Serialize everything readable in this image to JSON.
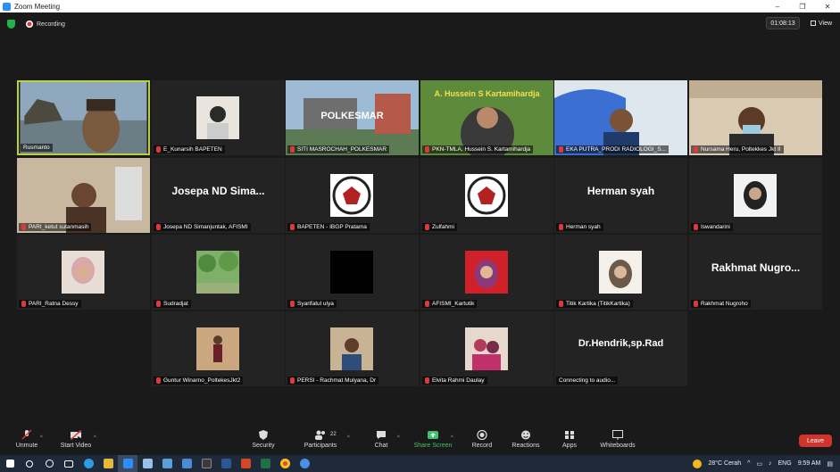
{
  "window": {
    "title": "Zoom Meeting",
    "min": "–",
    "max": "❐",
    "close": "✕"
  },
  "topbar": {
    "recording_label": "Recording",
    "timer": "01:08:13",
    "view_label": "View"
  },
  "participants": [
    {
      "name": "Rusmanto",
      "type": "video",
      "muted": false
    },
    {
      "name": "E_Kunarsih BAPETEN",
      "type": "photo",
      "muted": true
    },
    {
      "name": "SITI MASROCHAH_POLKESMAR",
      "type": "video",
      "muted": true,
      "overlay_text": "POLKESMAR"
    },
    {
      "name": "PKN-TMLA, Hussein S. Kartamihardja",
      "type": "video",
      "muted": true,
      "overlay_text": "A. Hussein S Kartamihardja"
    },
    {
      "name": "EKA PUTRA_PRODI RADIOLOGI_S...",
      "type": "video",
      "muted": true
    },
    {
      "name": "Nursama Heru, Poltekkes Jkt II",
      "type": "video",
      "muted": true
    },
    {
      "name": "PARI_ketut sutanmasih",
      "type": "video",
      "muted": true
    },
    {
      "name": "Josepa ND Simanjuntak, AFISMI",
      "type": "text",
      "muted": true,
      "display": "Josepa ND Sima..."
    },
    {
      "name": "BAPETEN - IBGP Pratama",
      "type": "logo",
      "muted": true
    },
    {
      "name": "Zulfahmi",
      "type": "logo",
      "muted": true
    },
    {
      "name": "Herman syah",
      "type": "text",
      "muted": true,
      "display": "Herman syah"
    },
    {
      "name": "Iswandarini",
      "type": "photo",
      "muted": true
    },
    {
      "name": "PARI_Ratna Dessy",
      "type": "photo",
      "muted": true
    },
    {
      "name": "Sudradjat",
      "type": "photo",
      "muted": true
    },
    {
      "name": "Syarifatul ulya",
      "type": "photo",
      "muted": true
    },
    {
      "name": "AFISMI_Kartutik",
      "type": "photo",
      "muted": true
    },
    {
      "name": "Titik Kartika (TitikKartika)",
      "type": "photo",
      "muted": true
    },
    {
      "name": "Rakhmat Nugroho",
      "type": "text",
      "muted": true,
      "display": "Rakhmat Nugro..."
    },
    {
      "name": "Guntur Winarno_PoltekesJkt2",
      "type": "photo",
      "muted": true
    },
    {
      "name": "PERSI - Rachmat Mulyana, Dr",
      "type": "photo",
      "muted": true
    },
    {
      "name": "Elvita Rahmi Daulay",
      "type": "photo",
      "muted": true
    },
    {
      "name": "Connecting to audio...",
      "type": "text",
      "muted": false,
      "display": "Dr.Hendrik,sp.Rad"
    }
  ],
  "toolbar": {
    "unmute": "Unmute",
    "start_video": "Start Video",
    "security": "Security",
    "participants": "Participants",
    "participants_count": "22",
    "chat": "Chat",
    "share_screen": "Share Screen",
    "record": "Record",
    "reactions": "Reactions",
    "apps": "Apps",
    "whiteboards": "Whiteboards",
    "leave": "Leave"
  },
  "taskbar": {
    "weather": "28°C Cerah",
    "language": "ENG",
    "time": "9:59 AM"
  },
  "colors": {
    "active_speaker": "#b9d23b",
    "share": "#3fc36a",
    "leave": "#d0342c",
    "muted": "#e0373a"
  }
}
